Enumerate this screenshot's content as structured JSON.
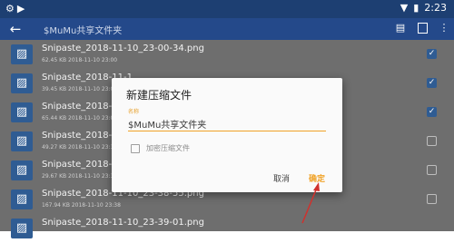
{
  "status_bar": {
    "left_icons": [
      "settings-icon",
      "play-icon"
    ],
    "time": "2:23",
    "right_icons": [
      "wifi-icon",
      "battery-icon"
    ]
  },
  "toolbar": {
    "title": "$MuMu共享文件夹",
    "icons": [
      "back-arrow-icon",
      "archive-icon",
      "select-all-icon",
      "more-icon"
    ]
  },
  "files": [
    {
      "name": "Snipaste_2018-11-10_23-00-34.png",
      "meta": "62.45 KB 2018-11-10 23:00",
      "checked": true
    },
    {
      "name": "Snipaste_2018-11-1",
      "meta": "39.45 KB 2018-11-10 23:07",
      "checked": true
    },
    {
      "name": "Snipaste_2018-11-1",
      "meta": "65.44 KB 2018-11-10 23:07",
      "checked": true
    },
    {
      "name": "Snipaste_2018-11-1",
      "meta": "49.27 KB 2018-11-10 23:35",
      "checked": false
    },
    {
      "name": "Snipaste_2018-11-1",
      "meta": "29.67 KB 2018-11-10 23:36",
      "checked": false
    },
    {
      "name": "Snipaste_2018-11-10_23-38-55.png",
      "meta": "167.94 KB 2018-11-10 23:38",
      "checked": false
    },
    {
      "name": "Snipaste_2018-11-10_23-39-01.png",
      "meta": "",
      "checked": false
    }
  ],
  "dialog": {
    "title": "新建压缩文件",
    "field_label": "名称",
    "field_value": "$MuMu共享文件夹",
    "encrypt_label": "加密压缩文件",
    "cancel_label": "取消",
    "ok_label": "确定"
  },
  "colors": {
    "status_bar": "#1d3f72",
    "toolbar": "#24498a",
    "accent": "#f0a227",
    "annotation_arrow": "#d0312d"
  }
}
